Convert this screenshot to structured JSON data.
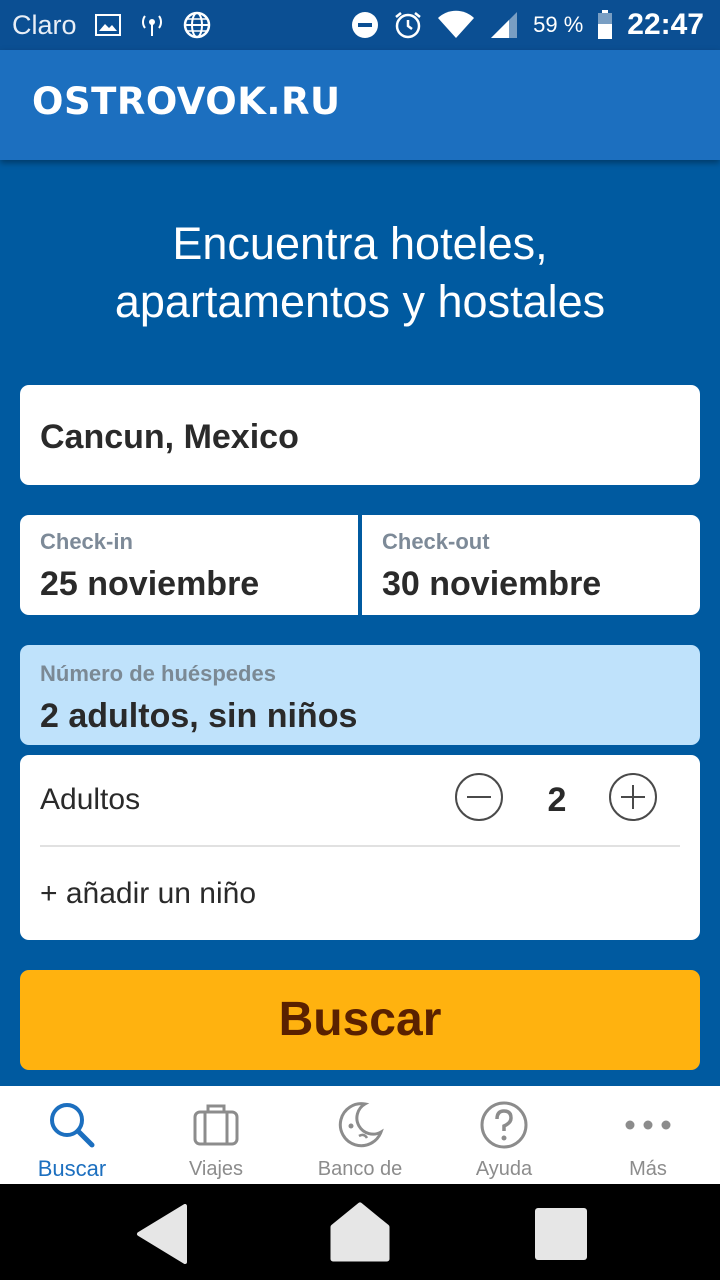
{
  "status_bar": {
    "carrier": "Claro",
    "battery": "59 %",
    "time": "22:47",
    "icons": [
      "image-icon",
      "hotspot-icon",
      "globe-icon",
      "dnd-icon",
      "alarm-icon",
      "wifi-icon",
      "signal-icon",
      "battery-icon"
    ]
  },
  "app_bar": {
    "logo": "OSTROVOK.RU"
  },
  "headline": {
    "line1": "Encuentra hoteles,",
    "line2": "apartamentos y hostales"
  },
  "destination": {
    "value": "Cancun, Mexico"
  },
  "dates": {
    "checkin_label": "Check-in",
    "checkin_value": "25 noviembre",
    "checkout_label": "Check-out",
    "checkout_value": "30 noviembre"
  },
  "guests": {
    "label": "Número de huéspedes",
    "value": "2 adultos, sin niños",
    "adults_label": "Adultos",
    "adults_count": "2",
    "add_child": "+ añadir un niño"
  },
  "search_button": {
    "label": "Buscar"
  },
  "bottom_nav": {
    "items": [
      {
        "label": "Buscar",
        "icon": "search-icon",
        "active": true
      },
      {
        "label": "Viajes",
        "icon": "suitcase-icon",
        "active": false
      },
      {
        "label": "Banco de",
        "icon": "moon-icon",
        "active": false
      },
      {
        "label": "Ayuda",
        "icon": "help-icon",
        "active": false
      },
      {
        "label": "Más",
        "icon": "more-icon",
        "active": false
      }
    ]
  },
  "colors": {
    "background": "#005aa0",
    "app_bar": "#1c6fbf",
    "accent_button": "#ffb20f",
    "guests_highlight": "#bfe2fb",
    "active_nav": "#1c6fbf"
  }
}
